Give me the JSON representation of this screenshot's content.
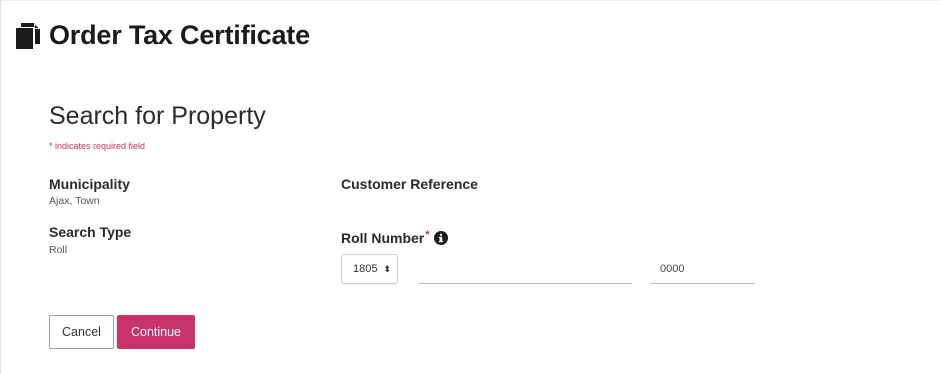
{
  "header": {
    "title": "Order Tax Certificate",
    "icon": "copy-icon"
  },
  "form": {
    "section_title": "Search for Property",
    "required_note": "* indicates required field",
    "municipality": {
      "label": "Municipality",
      "value": "Ajax, Town"
    },
    "search_type": {
      "label": "Search Type",
      "value": "Roll"
    },
    "customer_reference": {
      "label": "Customer Reference"
    },
    "roll_number": {
      "label": "Roll Number",
      "required_marker": "*",
      "info_icon": "info-icon",
      "prefix_selected": "1805",
      "main_value": "",
      "suffix_placeholder": "0000"
    }
  },
  "actions": {
    "cancel_label": "Cancel",
    "continue_label": "Continue"
  },
  "colors": {
    "accent": "#c8336a",
    "text": "#222222"
  }
}
